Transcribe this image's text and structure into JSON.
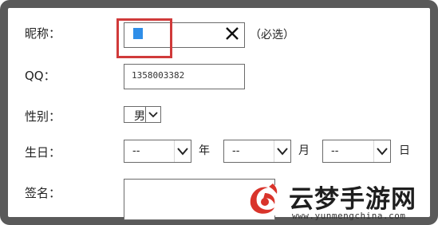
{
  "form": {
    "nickname": {
      "label": "昵称：",
      "value": "",
      "hint": "（必选）"
    },
    "qq": {
      "label": "QQ：",
      "value": "1358003382"
    },
    "gender": {
      "label": "性别：",
      "selected": "男"
    },
    "birthday": {
      "label": "生日：",
      "year": {
        "selected": "--",
        "unit": "年"
      },
      "month": {
        "selected": "--",
        "unit": "月"
      },
      "day": {
        "selected": "--",
        "unit": "日"
      }
    },
    "signature": {
      "label": "签名：",
      "value": ""
    }
  },
  "watermark": {
    "title": "云梦手游网",
    "url": "www.yunmengchina.com"
  },
  "colors": {
    "highlight": "#d03a3a",
    "cursor": "#2f8ee8",
    "logo_red": "#d9342b"
  }
}
